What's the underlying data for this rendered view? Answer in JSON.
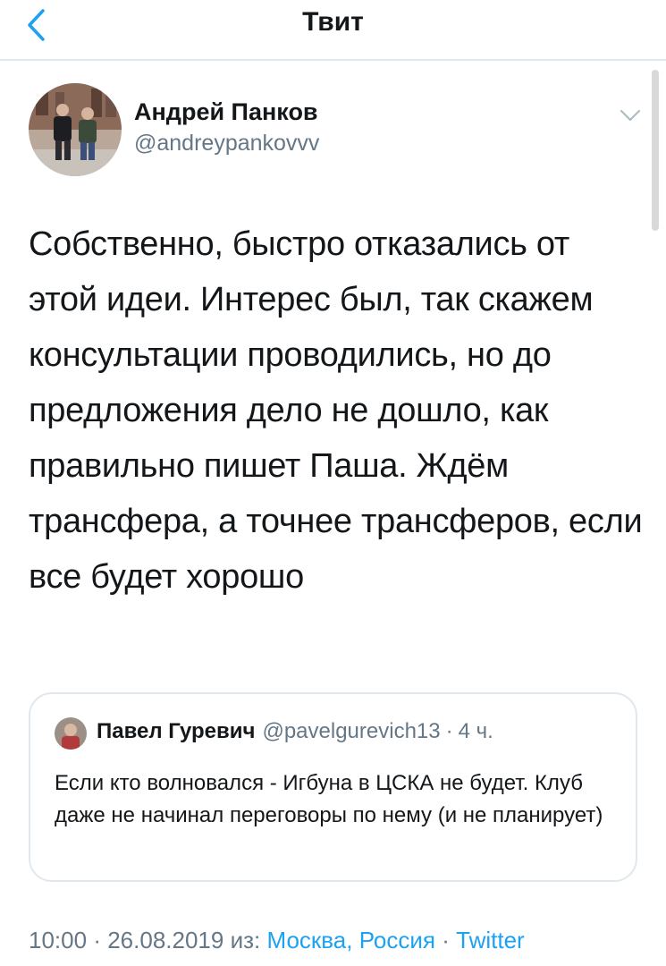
{
  "header": {
    "title": "Твит",
    "back_icon": "chevron-left-icon",
    "accent_color": "#1da1f2"
  },
  "tweet": {
    "author_name": "Андрей Панков",
    "author_handle": "@andreypankovvv",
    "menu_icon": "chevron-down-icon",
    "text": "Собственно, быстро отказались от этой идеи. Интерес был, так скажем консультации проводились, но до предложения дело не дошло, как правильно пишет Паша. Ждём трансфера, а точнее трансферов, если все будет хорошо"
  },
  "quoted_tweet": {
    "author_name": "Павел Гуревич",
    "author_handle": "@pavelgurevich13",
    "separator": "·",
    "time": "4 ч.",
    "text": "Если кто волновался - Игбуна в ЦСКА не будет. Клуб даже не начинал переговоры по нему (и не планирует)"
  },
  "meta": {
    "time": "10:00",
    "sep1": "·",
    "date": "26.08.2019",
    "from_label": "из:",
    "location": "Москва, Россия",
    "sep2": "·",
    "source": "Twitter"
  }
}
